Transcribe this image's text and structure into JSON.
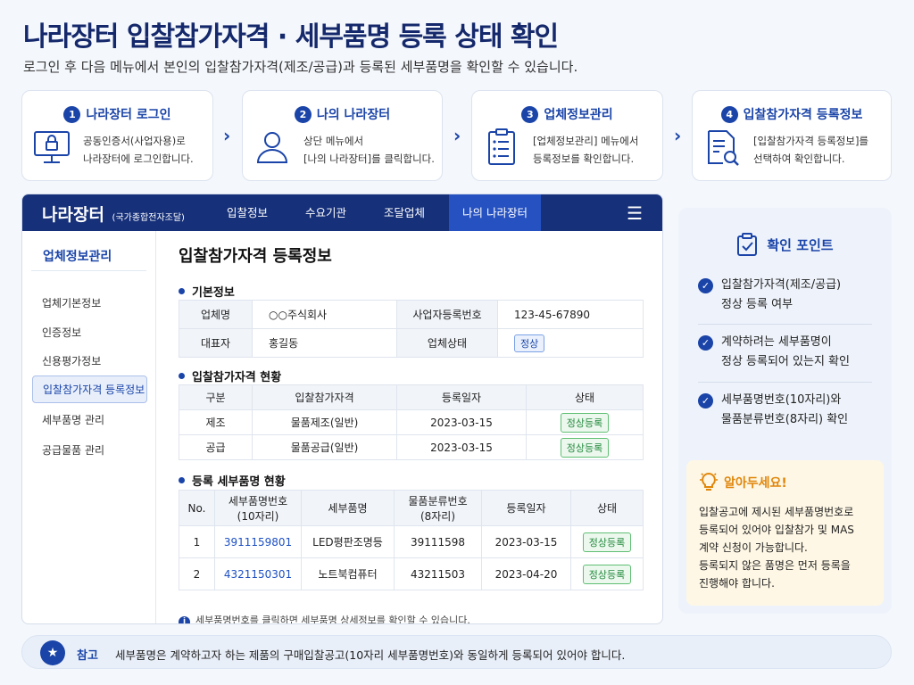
{
  "page": {
    "title": "나라장터 입찰참가자격 · 세부품명 등록 상태 확인",
    "subtitle": "로그인 후 다음 메뉴에서 본인의 입찰참가자격(제조/공급)과 등록된 세부품명을 확인할 수 있습니다."
  },
  "steps": [
    {
      "num": "1",
      "title": "나라장터 로그인",
      "icon": "monitor-lock-icon",
      "desc": "공동인증서(사업자용)로\n나라장터에 로그인합니다."
    },
    {
      "num": "2",
      "title": "나의 나라장터",
      "icon": "user-icon",
      "desc": "상단 메뉴에서\n[나의 나라장터]를 클릭합니다."
    },
    {
      "num": "3",
      "title": "업체정보관리",
      "icon": "clipboard-icon",
      "desc": "[업체정보관리] 메뉴에서\n등록정보를 확인합니다."
    },
    {
      "num": "4",
      "title": "입찰참가자격 등록정보",
      "icon": "document-search-icon",
      "desc": "[입찰참가자격 등록정보]를\n선택하여 확인합니다."
    }
  ],
  "step_arrow": "›",
  "nav": {
    "brand": "나라장터",
    "brand_sub": "(국가종합전자조달)",
    "items": [
      "입찰정보",
      "수요기관",
      "조달업체",
      "나의 나라장터"
    ],
    "menu_icon": "☰"
  },
  "sidebar": {
    "heading": "업체정보관리",
    "items": [
      "업체기본정보",
      "인증정보",
      "신용평가정보",
      "입찰참가자격 등록정보",
      "세부품명 관리",
      "공급물품 관리"
    ]
  },
  "content": {
    "title": "입찰참가자격 등록정보",
    "basic": {
      "heading": "기본정보",
      "company_label": "업체명",
      "company": "○○주식회사",
      "bizno_label": "사업자등록번호",
      "bizno": "123-45-67890",
      "ceo_label": "대표자",
      "ceo": "홍길동",
      "status_label": "업체상태",
      "status": "정상"
    },
    "qual": {
      "heading": "입찰참가자격 현황",
      "headers": [
        "구분",
        "입찰참가자격",
        "등록일자",
        "상태"
      ],
      "rows": [
        [
          "제조",
          "물품제조(일반)",
          "2023-03-15",
          "정상등록"
        ],
        [
          "공급",
          "물품공급(일반)",
          "2023-03-15",
          "정상등록"
        ]
      ]
    },
    "items": {
      "heading": "등록 세부품명 현황",
      "headers": [
        "No.",
        "세부품명번호\n(10자리)",
        "세부품명",
        "물품분류번호\n(8자리)",
        "등록일자",
        "상태"
      ],
      "rows": [
        [
          "1",
          "3911159801",
          "LED평판조명등",
          "39111598",
          "2023-03-15",
          "정상등록"
        ],
        [
          "2",
          "4321150301",
          "노트북컴퓨터",
          "43211503",
          "2023-04-20",
          "정상등록"
        ]
      ]
    },
    "note_icon": "i",
    "note": "세부품명번호를 클릭하면 세부품명 상세정보를 확인할 수 있습니다."
  },
  "checkpoints": {
    "title": "확인 포인트",
    "check_glyph": "✓",
    "items": [
      "입찰참가자격(제조/공급)\n정상 등록 여부",
      "계약하려는 세부품명이\n정상 등록되어 있는지 확인",
      "세부품명번호(10자리)와\n물품분류번호(8자리) 확인"
    ]
  },
  "tip": {
    "title": "알아두세요!",
    "body": "입찰공고에 제시된 세부품명번호로\n등록되어 있어야 입찰참가 및 MAS\n계약 신청이 가능합니다.\n등록되지 않은 품명은 먼저 등록을\n진행해야 합니다."
  },
  "footer": {
    "star": "★",
    "label": "참고",
    "text": "세부품명은 계약하고자 하는 제품의 구매입찰공고(10자리 세부품명번호)와 동일하게 등록되어 있어야 합니다."
  },
  "colors": {
    "primary": "#1a44a8",
    "nav": "#16307a",
    "nav_active": "#2551c1",
    "ok_green": "#238a3d",
    "tip_orange": "#e0860b"
  }
}
